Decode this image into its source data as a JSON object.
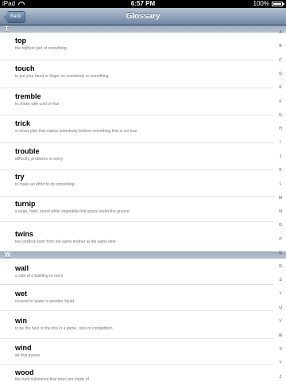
{
  "status_bar": {
    "device": "iPad",
    "time": "6:57 PM",
    "battery": "100%",
    "battery_level": 1.0
  },
  "nav": {
    "back_label": "Back",
    "title": "Glossary"
  },
  "sections": [
    {
      "letter": "T",
      "entries": [
        {
          "word": "top",
          "definition": "the highest part of something"
        },
        {
          "word": "touch",
          "definition": "to put your hand or finger on somebody or something"
        },
        {
          "word": "tremble",
          "definition": "to shake with cold or fear"
        },
        {
          "word": "trick",
          "definition": "a clever plan that makes somebody believe something that is not true"
        },
        {
          "word": "trouble",
          "definition": "difficulty, problems or worry"
        },
        {
          "word": "try",
          "definition": "to make an effort to do something"
        },
        {
          "word": "turnip",
          "definition": "a large, hard, round white vegetable that grows under the ground"
        },
        {
          "word": "twins",
          "definition": "two children born from the same mother at the same time"
        }
      ]
    },
    {
      "letter": "W",
      "entries": [
        {
          "word": "wall",
          "definition": "a side of a building or room"
        },
        {
          "word": "wet",
          "definition": "covered in water or another liquid"
        },
        {
          "word": "win",
          "definition": "to be the best or the first in a game, race or competition"
        },
        {
          "word": "wind",
          "definition": "air that moves"
        },
        {
          "word": "wood",
          "definition": "the hard substance that trees are made of"
        }
      ]
    }
  ],
  "index_letters": [
    "A",
    "B",
    "C",
    "D",
    "E",
    "F",
    "G",
    "H",
    "I",
    "J",
    "K",
    "L",
    "M",
    "N",
    "O",
    "P",
    "Q",
    "R",
    "S",
    "T",
    "U",
    "V",
    "W",
    "X",
    "Y",
    "Z"
  ]
}
